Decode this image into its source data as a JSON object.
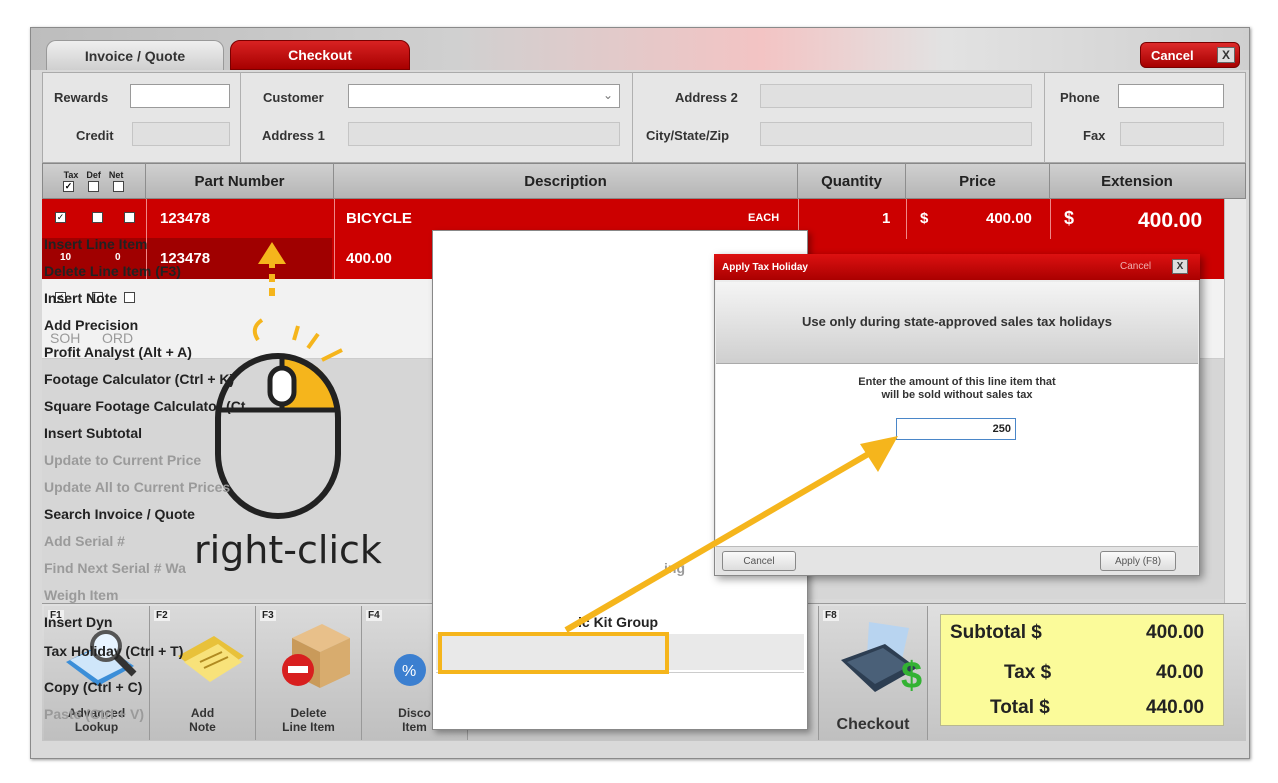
{
  "tabs": {
    "invoice": "Invoice / Quote",
    "checkout": "Checkout",
    "cancel": "Cancel",
    "close": "X"
  },
  "fields": {
    "rewards": "Rewards",
    "credit": "Credit",
    "customer": "Customer",
    "address1": "Address 1",
    "address2": "Address 2",
    "city": "City/State/Zip",
    "phone": "Phone",
    "fax": "Fax"
  },
  "grid": {
    "headers": {
      "tax": "Tax",
      "def": "Def",
      "net": "Net",
      "part": "Part Number",
      "desc": "Description",
      "qty": "Quantity",
      "price": "Price",
      "ext": "Extension"
    },
    "row1": {
      "part": "123478",
      "desc": "BICYCLE",
      "unit": "EACH",
      "qty": "1",
      "cur": "$",
      "price": "400.00",
      "extcur": "$",
      "ext": "400.00"
    },
    "row1b": {
      "a": "10",
      "b": "0",
      "part": "123478",
      "val": "400.00"
    },
    "row2": {
      "soh": "SOH",
      "ord": "ORD"
    }
  },
  "annotation": {
    "label": "right-click"
  },
  "context_menu": [
    {
      "label": "Insert Line Item",
      "enabled": true
    },
    {
      "label": "Delete Line Item (F3)",
      "enabled": true
    },
    {
      "label": "Insert Note",
      "enabled": true
    },
    {
      "label": "Add Precision",
      "enabled": true
    },
    {
      "label": "Profit Analyst (Alt + A)",
      "enabled": true
    },
    {
      "label": "Footage Calculator (Ctrl + K)",
      "enabled": true
    },
    {
      "label": "Square Footage Calculator (Ct",
      "enabled": true
    },
    {
      "label": "Insert Subtotal",
      "enabled": true
    },
    {
      "label": "Update to Current Price",
      "enabled": false
    },
    {
      "label": "Update All to Current Prices",
      "enabled": false
    },
    {
      "label": "Search Invoice / Quote",
      "enabled": true
    },
    {
      "label": "Add Serial #",
      "enabled": false
    },
    {
      "label": "Find Next Serial # Wa",
      "enabled": false
    },
    {
      "label": "ing",
      "enabled": false
    },
    {
      "label": "Weigh Item",
      "enabled": false
    },
    {
      "label": "Insert Dyn",
      "enabled": true
    },
    {
      "label": "ic Kit Group",
      "enabled": true
    },
    {
      "label": "Tax Holiday (Ctrl + T)",
      "enabled": true
    },
    {
      "label": "Copy (Ctrl + C)",
      "enabled": true
    },
    {
      "label": "Paste (Ctrl + V)",
      "enabled": false
    }
  ],
  "dialog": {
    "title": "Apply Tax Holiday",
    "cancel_top": "Cancel",
    "close": "X",
    "banner": "Use only during state-approved sales tax holidays",
    "prompt1": "Enter the amount of this line item that",
    "prompt2": "will be sold without sales tax",
    "amount": "250",
    "cancel_btn": "Cancel",
    "apply_btn": "Apply (F8)"
  },
  "fkeys": [
    {
      "key": "F1",
      "l1": "Advanced",
      "l2": "Lookup"
    },
    {
      "key": "F2",
      "l1": "Add",
      "l2": "Note"
    },
    {
      "key": "F3",
      "l1": "Delete",
      "l2": "Line Item"
    },
    {
      "key": "F4",
      "l1": "Disco",
      "l2": "Item"
    },
    {
      "key": "F8",
      "l1": "Checkout",
      "l2": ""
    }
  ],
  "totals": {
    "subtotal_label": "Subtotal $",
    "subtotal": "400.00",
    "tax_label": "Tax $",
    "tax": "40.00",
    "total_label": "Total $",
    "total": "440.00"
  },
  "colors": {
    "accent_red": "#cc0000",
    "highlight": "#f5b51c",
    "totals_bg": "#fbfb9a"
  }
}
